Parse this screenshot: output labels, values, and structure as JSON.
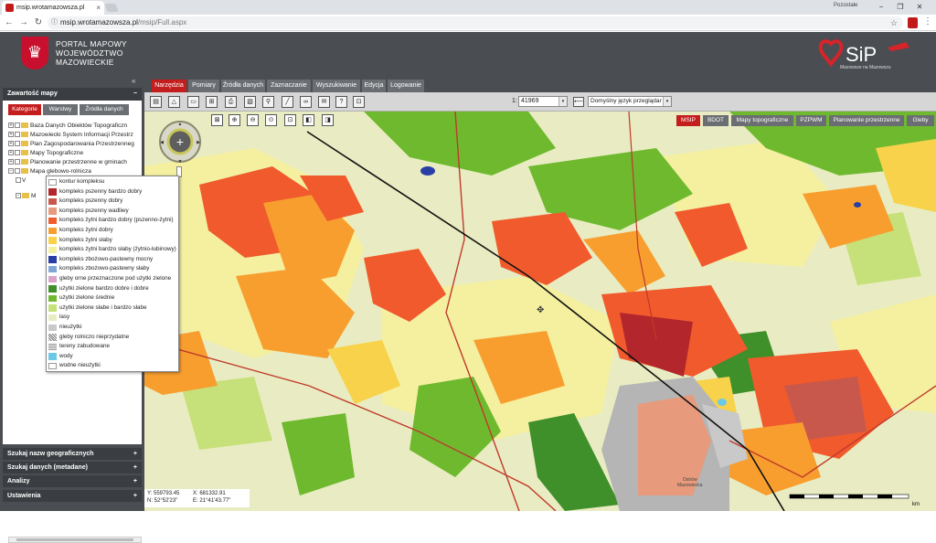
{
  "browser": {
    "tab_title": "msip.wrotamazowsza.pl",
    "tab_close": "×",
    "user_label": "Pozostałe",
    "url_domain": "msip.wrotamazowsza.pl",
    "url_path": "/msip/Full.aspx",
    "win_min": "−",
    "win_max": "❐",
    "win_close": "✕"
  },
  "header": {
    "portal_line1": "PORTAL MAPOWY",
    "portal_line2": "WOJEWÓDZTWO",
    "portal_line3": "MAZOWIECKIE",
    "sip_logo": "SiP",
    "sip_tagline": "Mazowsze na Mazowszu"
  },
  "left_panel": {
    "collapse": "«",
    "title": "Zawartość mapy",
    "title_toggle": "−",
    "subtabs": [
      "Kategorie",
      "Warstwy",
      "Źródła danych"
    ],
    "tree": [
      {
        "pm": "+",
        "label": "Baza Danych Obiektów Topograficzn"
      },
      {
        "pm": "+",
        "label": "Mazowiecki System Informacji Przestrz"
      },
      {
        "pm": "+",
        "label": "Plan Zagospodarowania Przestrzenneg"
      },
      {
        "pm": "+",
        "label": "Mapy Topograficzne"
      },
      {
        "pm": "+",
        "label": "Planowanie przestrzenne w gminach"
      },
      {
        "pm": "−",
        "label": "Mapa glebowo-rolnicza"
      },
      {
        "pm": "",
        "label": "V"
      },
      {
        "pm": "−",
        "label": "M"
      }
    ],
    "accordion": [
      {
        "label": "Szukaj nazw geograficznych",
        "sign": "+"
      },
      {
        "label": "Szukaj danych (metadane)",
        "sign": "+"
      },
      {
        "label": "Analizy",
        "sign": "+"
      },
      {
        "label": "Ustawienia",
        "sign": "+"
      }
    ]
  },
  "legend": [
    {
      "label": "kontur kompleksu",
      "color": "#ffffff"
    },
    {
      "label": "kompleks pszenny bardzo dobry",
      "color": "#b3262b"
    },
    {
      "label": "kompleks pszenny dobry",
      "color": "#c8584c"
    },
    {
      "label": "kompleks pszenny wadliwy",
      "color": "#e79a7c"
    },
    {
      "label": "kompleks żytni bardzo dobry (pszenno-żytni)",
      "color": "#f05a2c"
    },
    {
      "label": "kompleks żytni dobry",
      "color": "#f79e2f"
    },
    {
      "label": "kompleks żytni słaby",
      "color": "#f7d24a"
    },
    {
      "label": "kompleks żytni bardzo słaby (żytnio-łubinowy)",
      "color": "#f4f0a0"
    },
    {
      "label": "kompleks zbożowo-pastewny mocny",
      "color": "#2a3fa6"
    },
    {
      "label": "kompleks zbożowo-pastewny słaby",
      "color": "#7fa6d6"
    },
    {
      "label": "gleby orne przeznaczone pod użytki zielone",
      "color": "#d8a4c8"
    },
    {
      "label": "użytki zielone bardzo dobre i dobre",
      "color": "#3f8f2a"
    },
    {
      "label": "użytki zielone średnie",
      "color": "#6fb92f"
    },
    {
      "label": "użytki zielone słabe i bardzo słabe",
      "color": "#c6e07a"
    },
    {
      "label": "lasy",
      "color": "#e9ecc2"
    },
    {
      "label": "nieużytki",
      "color": "#c9c9c9"
    },
    {
      "label": "gleby rolniczo nieprzydatne",
      "color": "#8a8a8a"
    },
    {
      "label": "tereny zabudowane",
      "color": "#b5b5b5"
    },
    {
      "label": "wody",
      "color": "#6cc9e6"
    },
    {
      "label": "wodne nieużytki",
      "color": "#ffffff"
    }
  ],
  "main_tabs": [
    "Narzędzia",
    "Pomiary",
    "Źródła danych",
    "Zaznaczanie",
    "Wyszukiwanie",
    "Edycja",
    "Logowanie"
  ],
  "toolbar": {
    "scale_prefix": "1:",
    "scale_value": "41969",
    "dropdown_arrow": "▾",
    "language": "Domyślny język przeglądar"
  },
  "basemaps": [
    "MSIP",
    "BDOT",
    "Mapy topograficzne",
    "PZPWM",
    "Planowanie przestrzenne",
    "Gleby"
  ],
  "coords": {
    "y": "Y: 559793.45",
    "n": "N: 52°52'23\"",
    "x": "X: 681332.91",
    "e": "E: 21°41'43.77\""
  },
  "map": {
    "town_label_1": "Ostrów",
    "town_label_2": "Mazowiecka",
    "scale_unit": "km"
  }
}
